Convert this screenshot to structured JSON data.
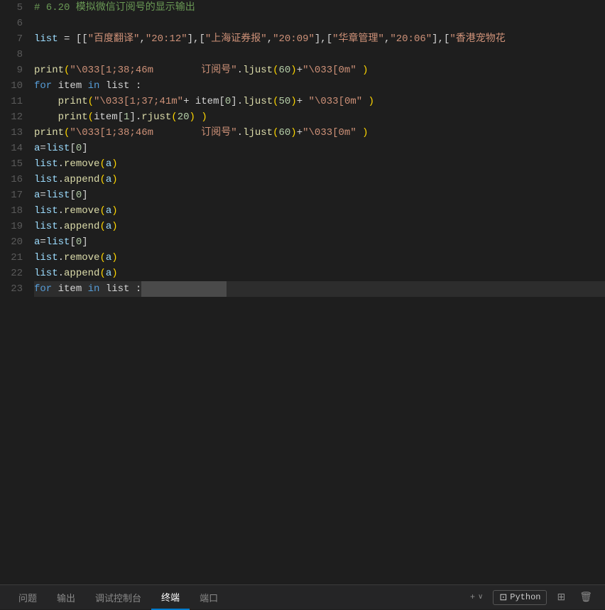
{
  "editor": {
    "background": "#1e1e1e",
    "lines": [
      {
        "num": 5,
        "content": "comment",
        "text": "# 6.20 模拟微信订阅号的显示输出"
      },
      {
        "num": 6,
        "content": "empty",
        "text": ""
      },
      {
        "num": 7,
        "content": "list_def",
        "text": "list = [[\"百度翻译\",\"20:12\"],[\"上海证券报\",\"20:09\"],[\"华章管理\",\"20:06\"],[\"香港宠物花"
      },
      {
        "num": 8,
        "content": "empty",
        "text": ""
      },
      {
        "num": 9,
        "content": "print1",
        "text": "print(\"\\033[1;38;46m        订阅号\".ljust(60)+\"\\033[0m\" )"
      },
      {
        "num": 10,
        "content": "for1",
        "text": "for item in list :"
      },
      {
        "num": 11,
        "content": "print2",
        "text": "    print(\"\\033[1;37;41m\"+ item[0].ljust(50)+ \"\\033[0m\" )"
      },
      {
        "num": 12,
        "content": "print3",
        "text": "    print(item[1].rjust(20) )"
      },
      {
        "num": 13,
        "content": "print4",
        "text": "print(\"\\033[1;38;46m        订阅号\".ljust(60)+\"\\033[0m\" )"
      },
      {
        "num": 14,
        "content": "assign1",
        "text": "a=list[0]"
      },
      {
        "num": 15,
        "content": "remove1",
        "text": "list.remove(a)"
      },
      {
        "num": 16,
        "content": "append1",
        "text": "list.append(a)"
      },
      {
        "num": 17,
        "content": "assign2",
        "text": "a=list[0]"
      },
      {
        "num": 18,
        "content": "remove2",
        "text": "list.remove(a)"
      },
      {
        "num": 19,
        "content": "append2",
        "text": "list.append(a)"
      },
      {
        "num": 20,
        "content": "assign3",
        "text": "a=list[0]"
      },
      {
        "num": 21,
        "content": "remove3",
        "text": "list.remove(a)"
      },
      {
        "num": 22,
        "content": "append3",
        "text": "list.append(a)"
      },
      {
        "num": 23,
        "content": "for2_current",
        "text": "for item in list :"
      }
    ]
  },
  "tabbar": {
    "tabs": [
      {
        "label": "问题",
        "active": false
      },
      {
        "label": "输出",
        "active": false
      },
      {
        "label": "调试控制台",
        "active": false
      },
      {
        "label": "终端",
        "active": true
      },
      {
        "label": "端口",
        "active": false
      }
    ],
    "right": {
      "plus_label": "+",
      "chevron_label": "∨",
      "terminal_label": "Python",
      "split_label": "⧉",
      "trash_label": "🗑"
    }
  }
}
